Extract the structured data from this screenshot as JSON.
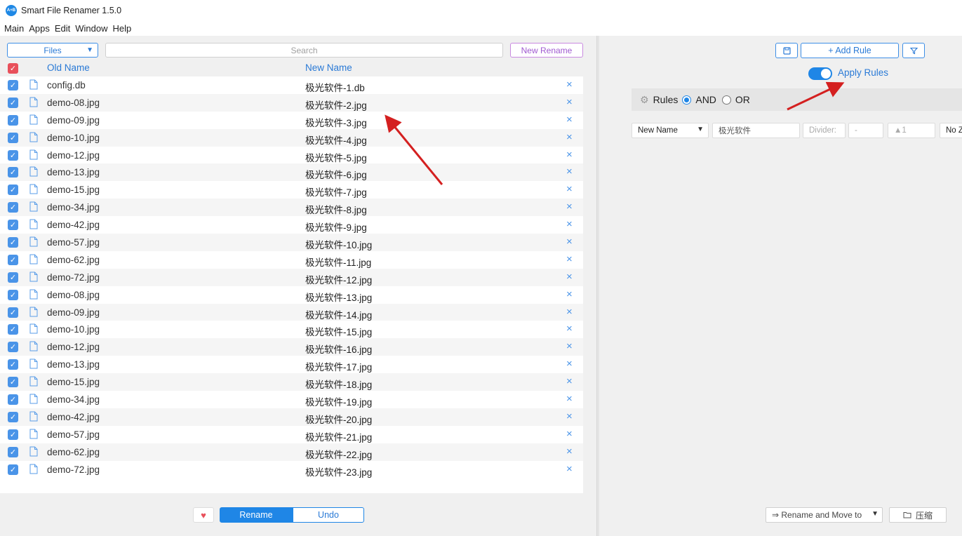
{
  "app": {
    "title": "Smart File Renamer 1.5.0",
    "logo_text": "A+B"
  },
  "menu": [
    "Main",
    "Apps",
    "Edit",
    "Window",
    "Help"
  ],
  "left": {
    "files_select": "Files",
    "search_placeholder": "Search",
    "new_rename": "New Rename",
    "header": {
      "old_name": "Old Name",
      "new_name": "New Name"
    },
    "rows": [
      {
        "old": "config.db",
        "new": "极光软件-1.db"
      },
      {
        "old": "demo-08.jpg",
        "new": "极光软件-2.jpg"
      },
      {
        "old": "demo-09.jpg",
        "new": "极光软件-3.jpg"
      },
      {
        "old": "demo-10.jpg",
        "new": "极光软件-4.jpg"
      },
      {
        "old": "demo-12.jpg",
        "new": "极光软件-5.jpg"
      },
      {
        "old": "demo-13.jpg",
        "new": "极光软件-6.jpg"
      },
      {
        "old": "demo-15.jpg",
        "new": "极光软件-7.jpg"
      },
      {
        "old": "demo-34.jpg",
        "new": "极光软件-8.jpg"
      },
      {
        "old": "demo-42.jpg",
        "new": "极光软件-9.jpg"
      },
      {
        "old": "demo-57.jpg",
        "new": "极光软件-10.jpg"
      },
      {
        "old": "demo-62.jpg",
        "new": "极光软件-11.jpg"
      },
      {
        "old": "demo-72.jpg",
        "new": "极光软件-12.jpg"
      },
      {
        "old": "demo-08.jpg",
        "new": "极光软件-13.jpg"
      },
      {
        "old": "demo-09.jpg",
        "new": "极光软件-14.jpg"
      },
      {
        "old": "demo-10.jpg",
        "new": "极光软件-15.jpg"
      },
      {
        "old": "demo-12.jpg",
        "new": "极光软件-16.jpg"
      },
      {
        "old": "demo-13.jpg",
        "new": "极光软件-17.jpg"
      },
      {
        "old": "demo-15.jpg",
        "new": "极光软件-18.jpg"
      },
      {
        "old": "demo-34.jpg",
        "new": "极光软件-19.jpg"
      },
      {
        "old": "demo-42.jpg",
        "new": "极光软件-20.jpg"
      },
      {
        "old": "demo-57.jpg",
        "new": "极光软件-21.jpg"
      },
      {
        "old": "demo-62.jpg",
        "new": "极光软件-22.jpg"
      },
      {
        "old": "demo-72.jpg",
        "new": "极光软件-23.jpg"
      }
    ],
    "rename_label": "Rename",
    "undo_label": "Undo"
  },
  "right": {
    "add_rule": "+ Add Rule",
    "apply_rules": "Apply Rules",
    "apply_on": true,
    "rules_label": "Rules",
    "and_label": "AND",
    "or_label": "OR",
    "rule": {
      "field": "New Name",
      "text": "极光软件",
      "divider": "Divider:",
      "dash": "-",
      "start": "▲1",
      "zero": "No Z"
    },
    "move_select": "⇒ Rename and Move to",
    "zip_label": "压缩"
  },
  "colors": {
    "accent": "#1f86e6",
    "danger": "#e8505b",
    "annotation_arrow": "#d42020"
  }
}
